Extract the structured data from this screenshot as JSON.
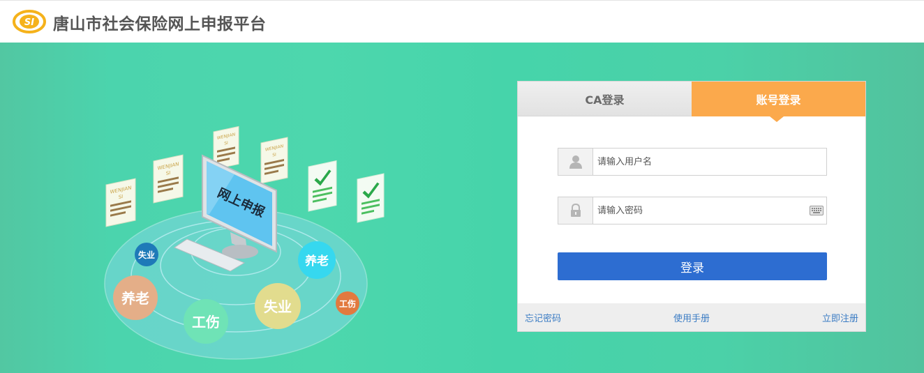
{
  "header": {
    "logo_text": "SI",
    "title": "唐山市社会保险网上申报平台"
  },
  "illustration": {
    "screen_text": "网上申报",
    "doc_label_top": "WENJIAN",
    "doc_label_bottom": "SI",
    "bubbles": [
      "失业",
      "养老",
      "养老",
      "工伤",
      "失业",
      "工伤"
    ]
  },
  "login": {
    "tabs": [
      {
        "label": "CA登录",
        "active": false
      },
      {
        "label": "账号登录",
        "active": true
      }
    ],
    "username": {
      "placeholder": "请输入用户名",
      "value": ""
    },
    "password": {
      "placeholder": "请输入密码",
      "value": ""
    },
    "submit_label": "登录",
    "links": {
      "forgot": "忘记密码",
      "manual": "使用手册",
      "register": "立即注册"
    }
  },
  "colors": {
    "brand_orange": "#fba94c",
    "primary_blue": "#2d6dd1",
    "banner_green": "#4bd4ad",
    "link_blue": "#3b7cc4"
  },
  "icons": [
    "logo-icon",
    "user-icon",
    "lock-icon",
    "keyboard-icon",
    "monitor-icon",
    "document-icon",
    "checkmark-icon"
  ]
}
